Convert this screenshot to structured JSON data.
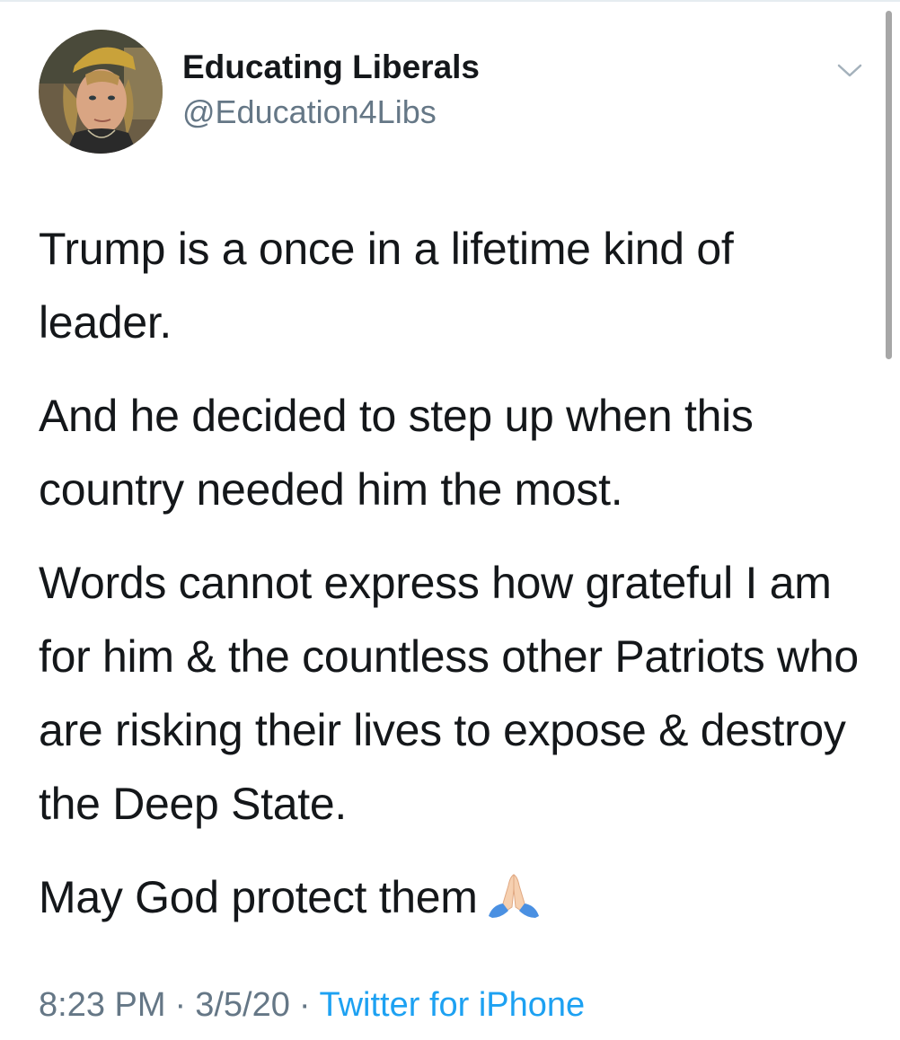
{
  "author": {
    "name": "Educating Liberals",
    "handle": "@Education4Libs",
    "avatar_icon": "profile-photo"
  },
  "menu": {
    "icon": "chevron-down-icon"
  },
  "tweet": {
    "paragraphs": [
      "Trump is a once in a lifetime kind of leader.",
      "And he decided to step up when this country needed him the most.",
      "Words cannot express how grateful I am for him & the countless other Patriots who are risking their lives to expose & destroy the Deep State.",
      "May God protect them"
    ],
    "emoji": "folded-hands-emoji"
  },
  "meta": {
    "time": "8:23 PM",
    "separator": "·",
    "date": "3/5/20",
    "source": "Twitter for iPhone"
  },
  "colors": {
    "text": "#14171a",
    "secondary": "#657786",
    "link": "#1da1f2"
  }
}
